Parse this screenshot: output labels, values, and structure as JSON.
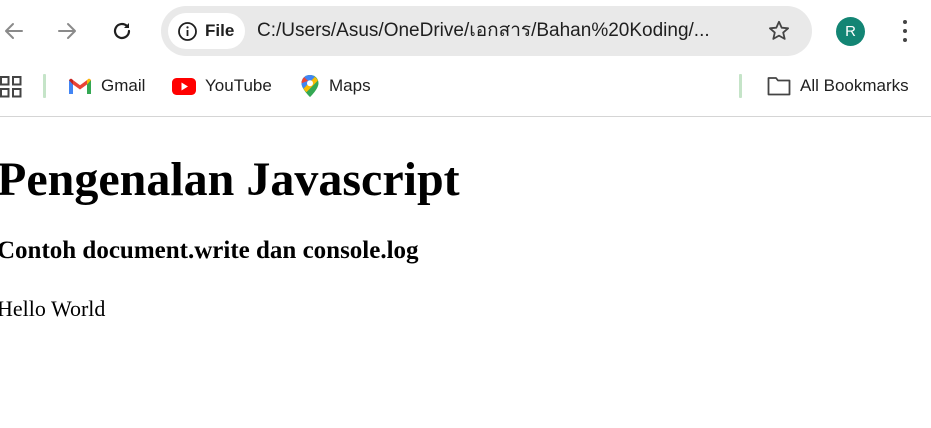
{
  "browser": {
    "omnibox": {
      "site_chip_label": "File",
      "url": "C:/Users/Asus/OneDrive/เอกสาร/Bahan%20Koding/..."
    },
    "profile_initial": "R",
    "icons": {
      "back": "back-arrow-icon",
      "forward": "forward-arrow-icon",
      "reload": "reload-icon",
      "info": "info-icon",
      "star": "star-icon",
      "menu": "kebab-menu-icon",
      "apps": "apps-grid-icon"
    },
    "colors": {
      "avatar_bg": "#138574",
      "omnibox_bg": "#e9e9e9",
      "bookmark_separator": "#c5e4c8"
    }
  },
  "bookmarks": {
    "items": [
      {
        "label": "Gmail",
        "icon": "gmail-icon"
      },
      {
        "label": "YouTube",
        "icon": "youtube-icon"
      },
      {
        "label": "Maps",
        "icon": "maps-icon"
      }
    ],
    "all_bookmarks": {
      "label": "All Bookmarks",
      "icon": "folder-icon"
    }
  },
  "page": {
    "heading": "Pengenalan Javascript",
    "subheading": "Contoh document.write dan console.log",
    "body_text": "Hello World"
  }
}
